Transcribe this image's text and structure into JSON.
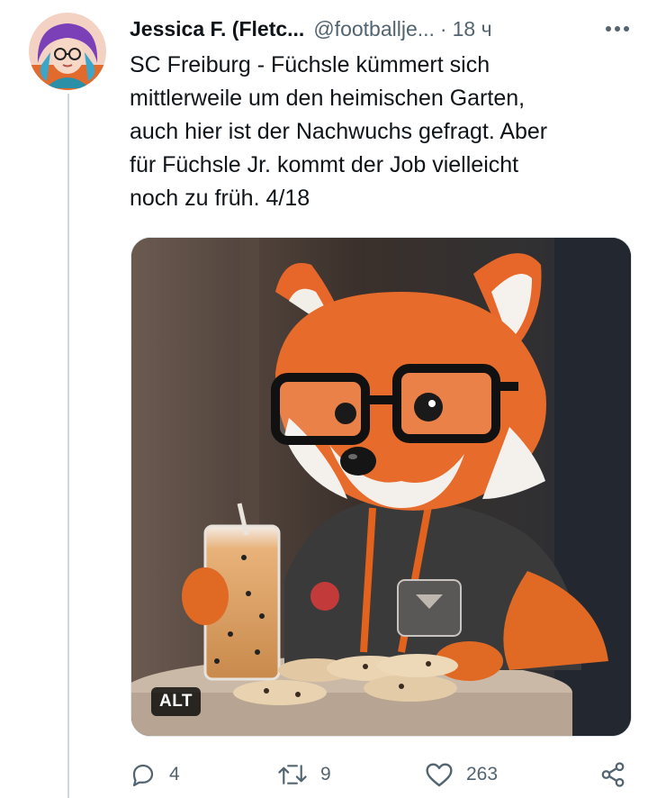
{
  "tweet": {
    "author_name": "Jessica F. (Fletc...",
    "author_handle": "@footballje...",
    "separator": "·",
    "timestamp": "18 ч",
    "more_label": "•••",
    "text": "SC Freiburg - Füchsle kümmert sich\nmittlerweile um den heimischen Garten,\nauch hier ist der Nachwuchs gefragt. Aber\nfür Füchsle Jr. kommt der Job vielleicht\nnoch zu früh. 4/18",
    "media": {
      "alt_badge": "ALT"
    },
    "actions": {
      "replies": "4",
      "retweets": "9",
      "likes": "263"
    }
  },
  "icons": {
    "reply": "reply-icon",
    "retweet": "retweet-icon",
    "like": "heart-icon",
    "share": "share-icon",
    "more": "more-icon"
  },
  "colors": {
    "text": "#0f1419",
    "secondary": "#536471",
    "thread_line": "#cfd9de"
  }
}
